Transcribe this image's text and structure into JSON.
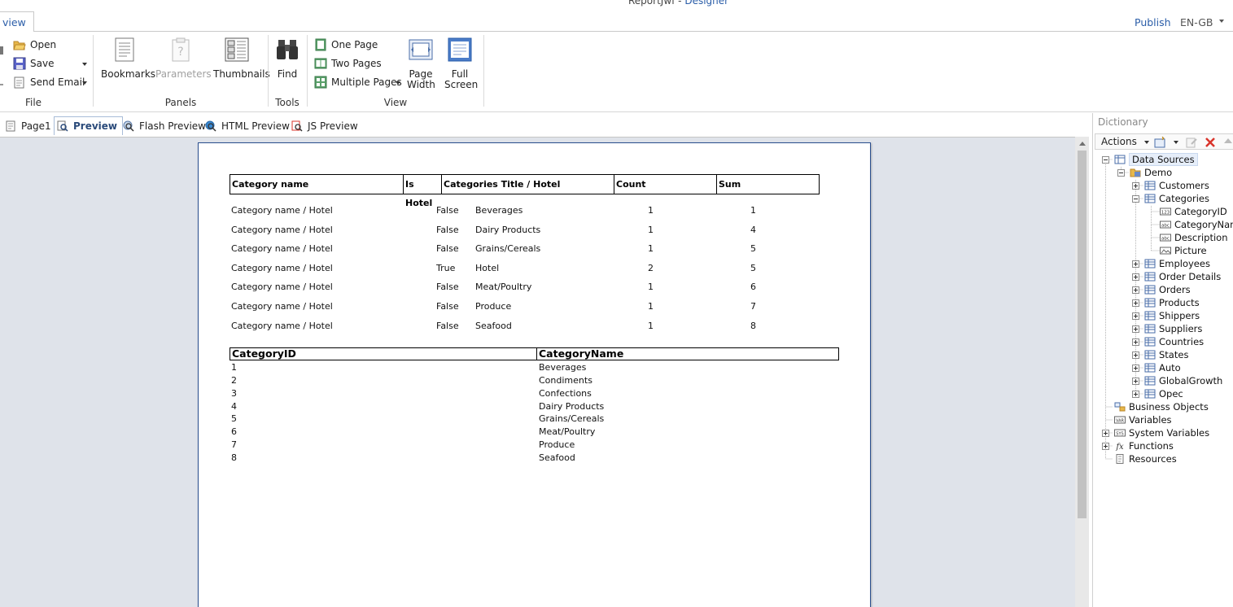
{
  "window": {
    "title": "ReportJwf",
    "mode": "Designer"
  },
  "tabs": {
    "active": "view",
    "publish": "Publish",
    "language": "EN-GB"
  },
  "ribbon": {
    "file": {
      "open": "Open",
      "save": "Save",
      "send_email": "Send Email",
      "label": "File"
    },
    "panels": {
      "bookmarks": "Bookmarks",
      "parameters": "Parameters",
      "thumbnails": "Thumbnails",
      "label": "Panels"
    },
    "tools": {
      "find": "Find",
      "label": "Tools"
    },
    "view": {
      "one_page": "One Page",
      "two_pages": "Two Pages",
      "multiple_pages": "Multiple Pages",
      "page_width_1": "Page",
      "page_width_2": "Width",
      "full_screen_1": "Full",
      "full_screen_2": "Screen",
      "label": "View"
    }
  },
  "preview_tabs": [
    "Page1",
    "Preview",
    "Flash Preview",
    "HTML Preview",
    "JS Preview"
  ],
  "report": {
    "headers": [
      "Category name",
      "Is Hotel",
      "Categories Title / Hotel",
      "Count",
      "Sum"
    ],
    "rows": [
      [
        "Category name / Hotel",
        "False",
        "Beverages",
        "1",
        "1"
      ],
      [
        "Category name / Hotel",
        "False",
        "Dairy Products",
        "1",
        "4"
      ],
      [
        "Category name / Hotel",
        "False",
        "Grains/Cereals",
        "1",
        "5"
      ],
      [
        "Category name / Hotel",
        "True",
        "Hotel",
        "2",
        "5"
      ],
      [
        "Category name / Hotel",
        "False",
        "Meat/Poultry",
        "1",
        "6"
      ],
      [
        "Category name / Hotel",
        "False",
        "Produce",
        "1",
        "7"
      ],
      [
        "Category name / Hotel",
        "False",
        "Seafood",
        "1",
        "8"
      ]
    ],
    "table2_headers": [
      "CategoryID",
      "CategoryName"
    ],
    "table2_rows": [
      [
        "1",
        "Beverages"
      ],
      [
        "2",
        "Condiments"
      ],
      [
        "3",
        "Confections"
      ],
      [
        "4",
        "Dairy Products"
      ],
      [
        "5",
        "Grains/Cereals"
      ],
      [
        "6",
        "Meat/Poultry"
      ],
      [
        "7",
        "Produce"
      ],
      [
        "8",
        "Seafood"
      ]
    ]
  },
  "dictionary": {
    "title": "Dictionary",
    "actions": "Actions",
    "tree": {
      "data_sources": "Data Sources",
      "demo": "Demo",
      "customers": "Customers",
      "categories": "Categories",
      "category_id": "CategoryID",
      "category_name": "CategoryName",
      "description": "Description",
      "picture": "Picture",
      "employees": "Employees",
      "order_details": "Order Details",
      "orders": "Orders",
      "products": "Products",
      "shippers": "Shippers",
      "suppliers": "Suppliers",
      "countries": "Countries",
      "states": "States",
      "auto": "Auto",
      "global_growth": "GlobalGrowth",
      "opec": "Opec",
      "business_objects": "Business Objects",
      "variables": "Variables",
      "system_variables": "System Variables",
      "functions": "Functions",
      "resources": "Resources"
    }
  },
  "colors": {
    "accent": "#2a5da8",
    "preview_bg": "#dfe3ea",
    "page_border": "#2a4e8e",
    "delete_red": "#d9342b"
  }
}
